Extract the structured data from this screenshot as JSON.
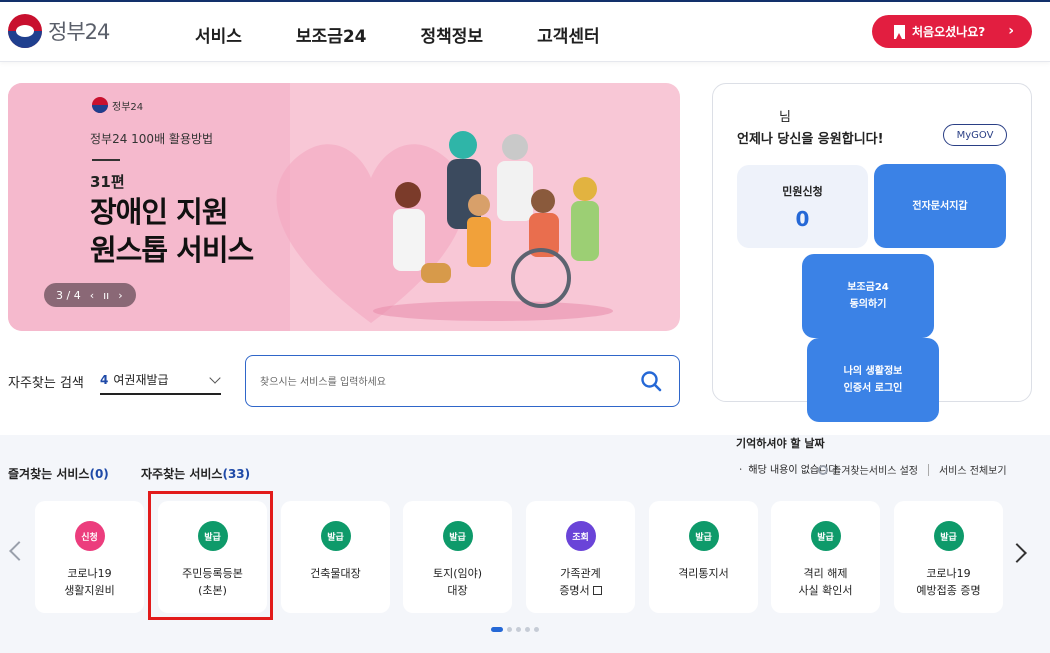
{
  "header": {
    "logo_text": "정부24",
    "nav": [
      "서비스",
      "보조금24",
      "정책정보",
      "고객센터"
    ],
    "first_visit_label": "처음오셨나요?",
    "first_visit_chevron": "›"
  },
  "banner": {
    "logo_text": "정부24",
    "subtitle": "정부24 100배 활용방법",
    "episode": "31편",
    "title_line1": "장애인 지원",
    "title_line2": "원스톱 서비스",
    "pager": {
      "current": "3 / 4",
      "prev": "‹",
      "pause": "ıı",
      "next": "›"
    }
  },
  "search": {
    "faq_label": "자주찾는 검색",
    "faq_rank": "4",
    "faq_value": "여권재발급",
    "placeholder": "찾으시는 서비스를 입력하세요"
  },
  "panel": {
    "greeting_name": "님",
    "greeting_msg": "언제나 당신을 응원합니다!",
    "mygov": "MyGOV",
    "minwon_label": "민원신청",
    "minwon_count": "0",
    "wallet_label": "전자문서지갑",
    "subsidy_line1": "보조금24",
    "subsidy_line2": "동의하기",
    "login_line1": "나의 생활정보",
    "login_line2": "인증서 로그인"
  },
  "remember": {
    "title": "기억하셔야 할 날짜",
    "sub": "ㆍ 해당 내용이 없습니다."
  },
  "services": {
    "favorites_label": "즐겨찾는 서비스",
    "favorites_count": "(0)",
    "often_label": "자주찾는 서비스",
    "often_count": "(33)",
    "setting_link": "즐겨찾는서비스 설정",
    "all_link": "서비스 전체보기",
    "items": [
      {
        "badge": "신청",
        "color": "#ec3d7d",
        "line1": "코로나19",
        "line2": "생활지원비"
      },
      {
        "badge": "발급",
        "color": "#0e9a6a",
        "line1": "주민등록등본",
        "line2": "(초본)"
      },
      {
        "badge": "발급",
        "color": "#0e9a6a",
        "line1": "건축물대장",
        "line2": ""
      },
      {
        "badge": "발급",
        "color": "#0e9a6a",
        "line1": "토지(임야)",
        "line2": "대장"
      },
      {
        "badge": "조회",
        "color": "#6a44d8",
        "line1": "가족관계",
        "line2": "증명서"
      },
      {
        "badge": "발급",
        "color": "#0e9a6a",
        "line1": "격리통지서",
        "line2": ""
      },
      {
        "badge": "발급",
        "color": "#0e9a6a",
        "line1": "격리 해제",
        "line2": "사실 확인서"
      },
      {
        "badge": "발급",
        "color": "#0e9a6a",
        "line1": "코로나19",
        "line2": "예방접종 증명"
      }
    ]
  }
}
